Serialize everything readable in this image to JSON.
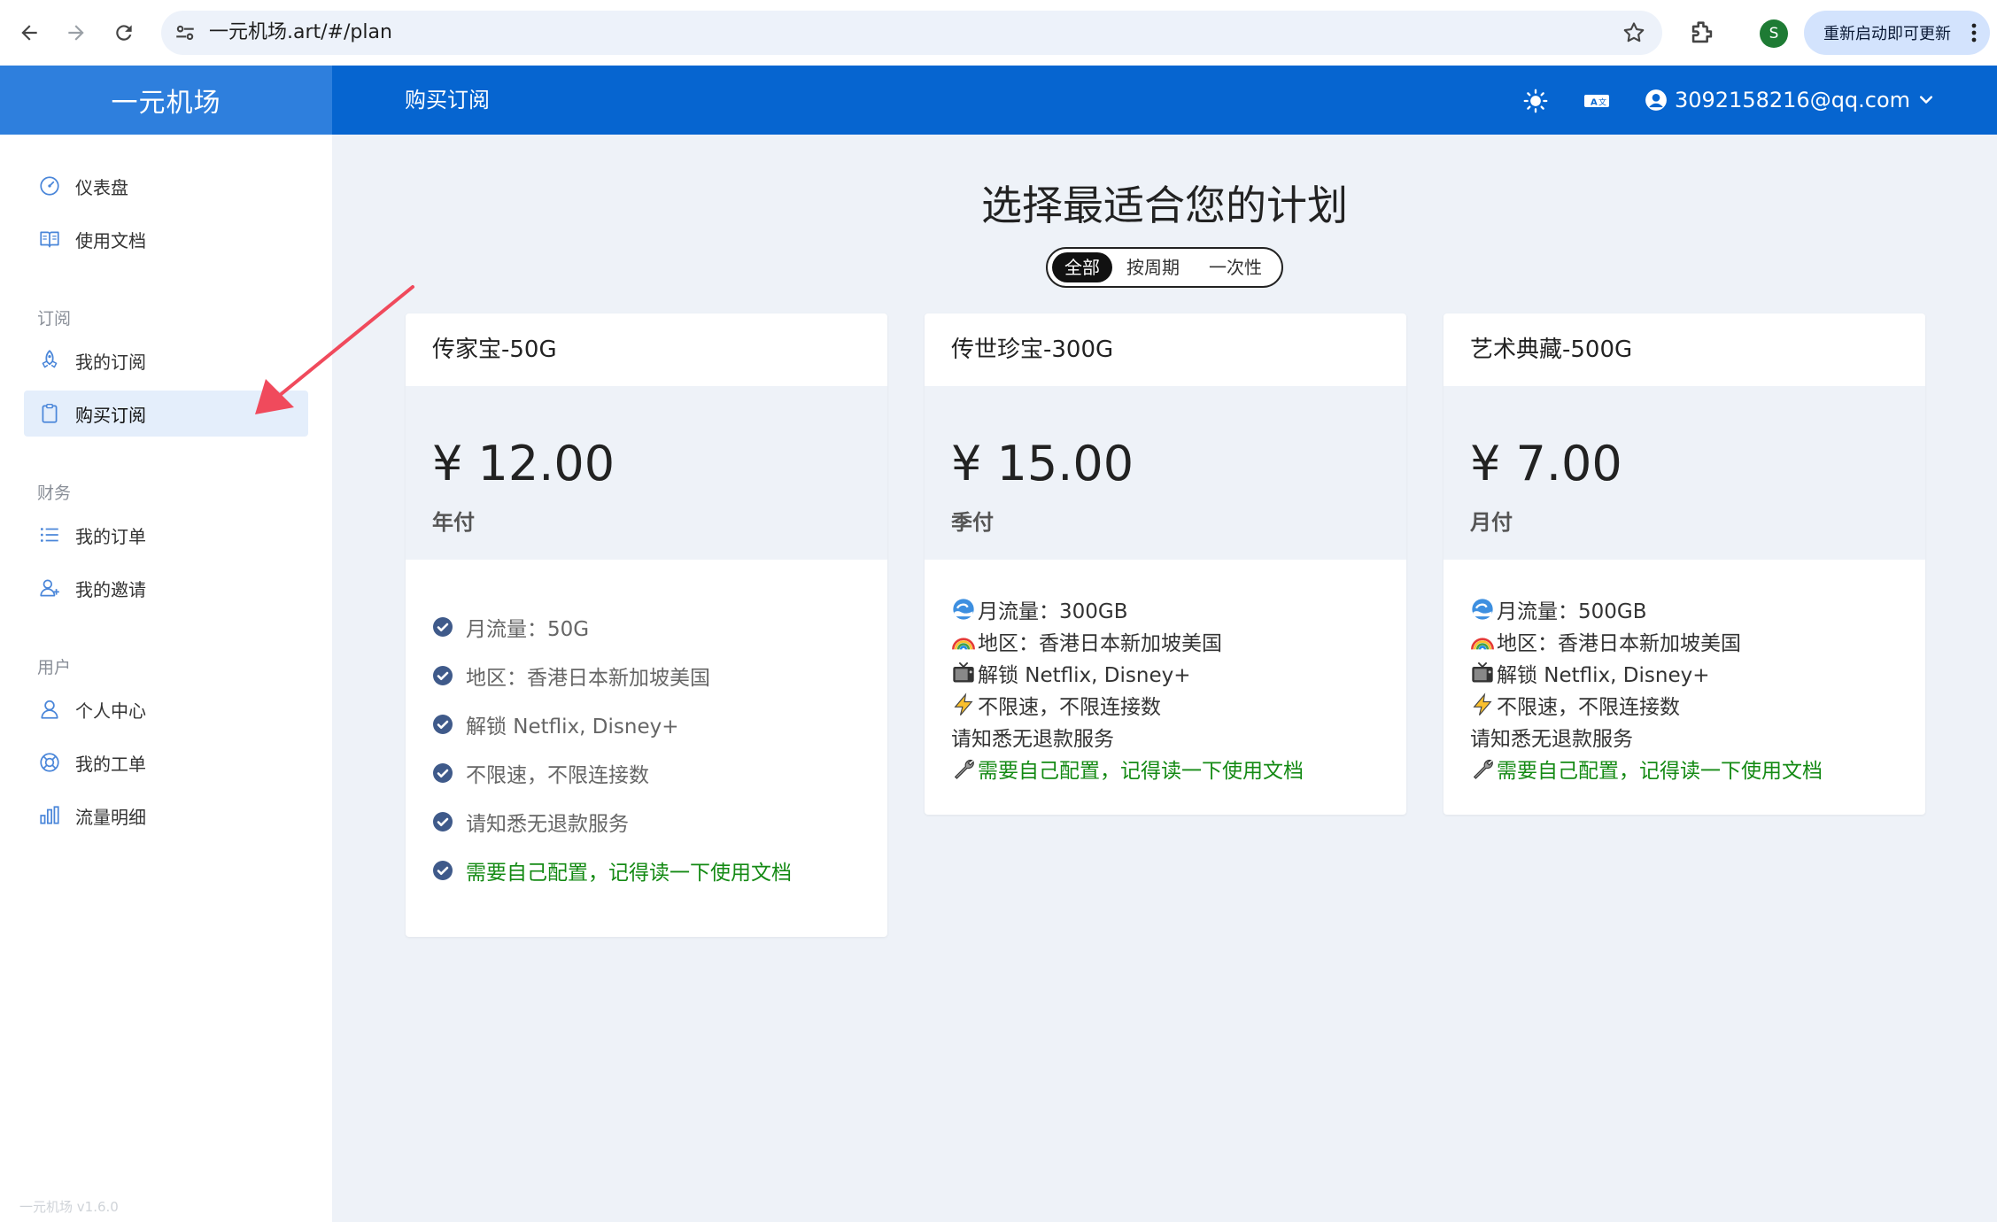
{
  "browser": {
    "url": "一元机场.art/#/plan",
    "update_label": "重新启动即可更新",
    "profile_initial": "S"
  },
  "header": {
    "brand": "一元机场",
    "title": "购买订阅",
    "user_email": "3092158216@qq.com"
  },
  "sidebar": {
    "items_top": [
      {
        "label": "仪表盘",
        "icon": "gauge-icon"
      },
      {
        "label": "使用文档",
        "icon": "book-icon"
      }
    ],
    "sections": [
      {
        "title": "订阅",
        "items": [
          {
            "label": "我的订阅",
            "icon": "rocket-icon"
          },
          {
            "label": "购买订阅",
            "icon": "clipboard-icon",
            "active": true
          }
        ]
      },
      {
        "title": "财务",
        "items": [
          {
            "label": "我的订单",
            "icon": "list-icon"
          },
          {
            "label": "我的邀请",
            "icon": "user-plus-icon"
          }
        ]
      },
      {
        "title": "用户",
        "items": [
          {
            "label": "个人中心",
            "icon": "user-icon"
          },
          {
            "label": "我的工单",
            "icon": "lifebuoy-icon"
          },
          {
            "label": "流量明细",
            "icon": "bar-chart-icon"
          }
        ]
      }
    ],
    "version": "一元机场 v1.6.0"
  },
  "main": {
    "title": "选择最适合您的计划",
    "tabs": [
      "全部",
      "按周期",
      "一次性"
    ],
    "active_tab": "全部",
    "plans": [
      {
        "name": "传家宝-50G",
        "price": "¥ 12.00",
        "period": "年付",
        "features": [
          "月流量：50G",
          "地区：香港日本新加坡美国",
          "解锁 Netflix, Disney+",
          "不限速，不限连接数",
          "请知悉无退款服务",
          "需要自己配置，记得读一下使用文档"
        ]
      },
      {
        "name": "传世珍宝-300G",
        "price": "¥ 15.00",
        "period": "季付",
        "features": [
          "月流量：300GB",
          "地区：香港日本新加坡美国",
          "解锁 Netflix, Disney+",
          "不限速，不限连接数",
          "请知悉无退款服务",
          "需要自己配置，记得读一下使用文档"
        ]
      },
      {
        "name": "艺术典藏-500G",
        "price": "¥ 7.00",
        "period": "月付",
        "features": [
          "月流量：500GB",
          "地区：香港日本新加坡美国",
          "解锁 Netflix, Disney+",
          "不限速，不限连接数",
          "请知悉无退款服务",
          "需要自己配置，记得读一下使用文档"
        ]
      }
    ]
  },
  "colors": {
    "header_blue": "#0665d0",
    "brand_blue": "#2e7fdd",
    "annotation_arrow": "#f04a5c",
    "feature_green": "#148a14"
  }
}
